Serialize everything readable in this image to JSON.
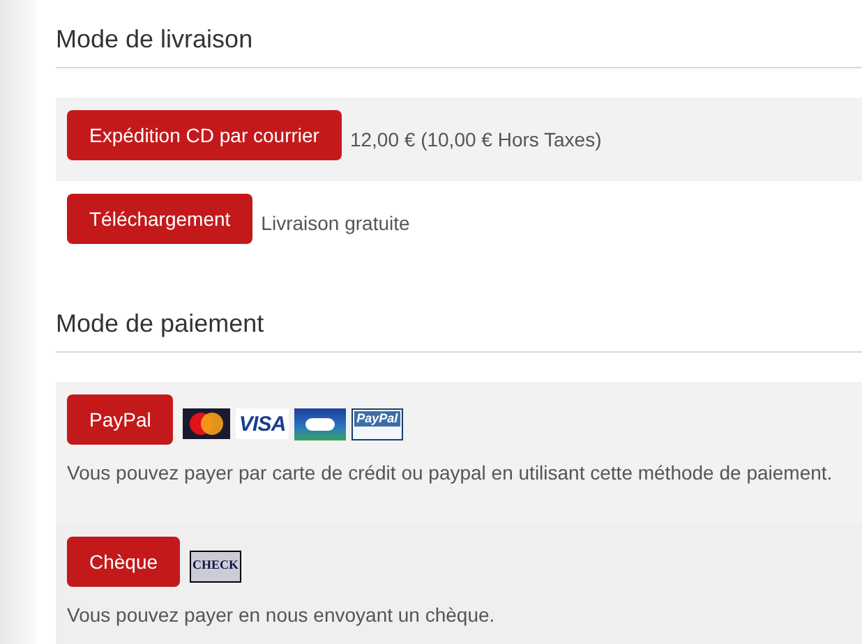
{
  "sections": [
    {
      "title": "Mode de livraison",
      "options": [
        {
          "label": "Expédition CD par courrier",
          "shaded": true,
          "price": "12,00 € (10,00 € Hors Taxes)"
        },
        {
          "label": "Téléchargement",
          "shaded": false,
          "price": "Livraison gratuite"
        }
      ]
    },
    {
      "title": "Mode de paiement",
      "options": [
        {
          "label": "PayPal",
          "shaded": true,
          "logos": [
            {
              "kind": "mastercard"
            },
            {
              "kind": "visa",
              "text": "VISA"
            },
            {
              "kind": "cb"
            },
            {
              "kind": "paypal",
              "text": "PayPal"
            }
          ],
          "description": "Vous pouvez payer par carte de crédit ou paypal en utilisant cette méthode de paiement."
        },
        {
          "label": "Chèque",
          "shaded": true,
          "logos": [
            {
              "kind": "check",
              "text": "CHECK"
            }
          ],
          "description": "Vous pouvez payer en nous envoyant un chèque."
        }
      ]
    }
  ]
}
